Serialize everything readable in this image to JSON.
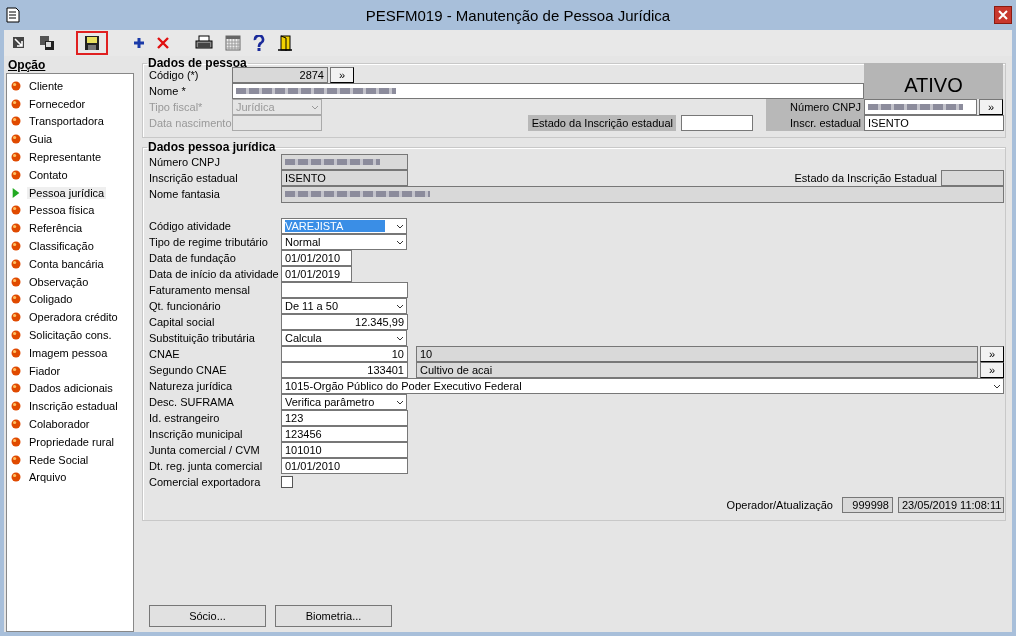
{
  "window": {
    "title": "PESFM019 - Manutenção de Pessoa Jurídica"
  },
  "toolbar_groups": [
    {
      "items": [
        {
          "kind": "arrow",
          "highlighted": false
        },
        {
          "kind": "windows",
          "highlighted": false
        }
      ]
    },
    {
      "items": [
        {
          "kind": "save",
          "highlighted": true
        }
      ]
    },
    {
      "items": [
        {
          "kind": "add",
          "highlighted": false
        },
        {
          "kind": "delete",
          "highlighted": false
        }
      ]
    },
    {
      "items": [
        {
          "kind": "print",
          "highlighted": false
        },
        {
          "kind": "calendar",
          "highlighted": false
        },
        {
          "kind": "help",
          "highlighted": false
        },
        {
          "kind": "exit",
          "highlighted": false
        }
      ]
    }
  ],
  "sidebar": {
    "title": "Opção",
    "items": [
      {
        "label": "Cliente",
        "selected": false
      },
      {
        "label": "Fornecedor",
        "selected": false
      },
      {
        "label": "Transportadora",
        "selected": false
      },
      {
        "label": "Guia",
        "selected": false
      },
      {
        "label": "Representante",
        "selected": false
      },
      {
        "label": "Contato",
        "selected": false
      },
      {
        "label": "Pessoa jurídica",
        "selected": true
      },
      {
        "label": "Pessoa física",
        "selected": false
      },
      {
        "label": "Referência",
        "selected": false
      },
      {
        "label": "Classificação",
        "selected": false
      },
      {
        "label": "Conta bancária",
        "selected": false
      },
      {
        "label": "Observação",
        "selected": false
      },
      {
        "label": "Coligado",
        "selected": false
      },
      {
        "label": "Operadora crédito",
        "selected": false
      },
      {
        "label": "Solicitação cons.",
        "selected": false
      },
      {
        "label": "Imagem pessoa",
        "selected": false
      },
      {
        "label": "Fiador",
        "selected": false
      },
      {
        "label": "Dados adicionais",
        "selected": false
      },
      {
        "label": "Inscrição estadual",
        "selected": false
      },
      {
        "label": "Colaborador",
        "selected": false
      },
      {
        "label": "Propriedade rural",
        "selected": false
      },
      {
        "label": "Rede Social",
        "selected": false
      },
      {
        "label": "Arquivo",
        "selected": false
      }
    ]
  },
  "dados_pessoa": {
    "title": "Dados de pessoa",
    "codigo": {
      "label": "Código (*)",
      "value": "2874",
      "button": "»"
    },
    "nome": {
      "label": "Nome *"
    },
    "tipo_fiscal": {
      "label": "Tipo fiscal*",
      "value": "Jurídica",
      "disabled": true
    },
    "data_nascimento": {
      "label": "Data nascimento",
      "disabled": true
    },
    "estado_inscricao": {
      "label": "Estado da Inscrição estadual"
    },
    "status": "ATIVO",
    "numero_cnpj": {
      "label": "Número CNPJ",
      "button": "»"
    },
    "inscr_estadual": {
      "label": "Inscr. estadual",
      "value": "ISENTO"
    }
  },
  "dados_pj": {
    "title": "Dados pessoa jurídica",
    "numero_cnpj": {
      "label": "Número CNPJ"
    },
    "inscricao_estadual": {
      "label": "Inscrição estadual",
      "value": "ISENTO"
    },
    "estado_inscricao": {
      "label": "Estado da Inscrição Estadual"
    },
    "nome_fantasia": {
      "label": "Nome fantasia"
    },
    "fields": [
      {
        "kind": "select",
        "label": "Código atividade",
        "value": "VAREJISTA",
        "selected": true
      },
      {
        "kind": "select",
        "label": "Tipo de regime tributário",
        "value": "Normal",
        "selected": false
      },
      {
        "kind": "date",
        "label": "Data de fundação",
        "value": "01/01/2010"
      },
      {
        "kind": "date",
        "label": "Data de início da atividade",
        "value": "01/01/2019"
      },
      {
        "kind": "text",
        "label": "Faturamento mensal"
      },
      {
        "kind": "select",
        "label": "Qt. funcionário",
        "value": "De 11 a 50",
        "selected": false
      },
      {
        "kind": "number",
        "label": "Capital social",
        "value": "12.345,99"
      },
      {
        "kind": "select",
        "label": "Substituição tributária",
        "value": "Calcula",
        "selected": false
      },
      {
        "kind": "code",
        "label": "CNAE",
        "value": "10",
        "description": "10",
        "button": "»"
      },
      {
        "kind": "code",
        "label": "Segundo CNAE",
        "value": "133401",
        "description": "Cultivo de acai",
        "button": "»"
      },
      {
        "kind": "wide_select",
        "label": "Natureza jurídica",
        "value": "1015-Orgão Público do Poder Executivo Federal"
      },
      {
        "kind": "select",
        "label": "Desc. SUFRAMA",
        "value": "Verifica parâmetro",
        "selected": false
      },
      {
        "kind": "text",
        "label": "Id. estrangeiro",
        "value": "123"
      },
      {
        "kind": "text",
        "label": "Inscrição municipal",
        "value": "123456"
      },
      {
        "kind": "text",
        "label": "Junta comercial / CVM",
        "value": "101010"
      },
      {
        "kind": "text",
        "label": "Dt. reg. junta comercial",
        "value": "01/01/2010"
      },
      {
        "kind": "checkbox",
        "label": "Comercial exportadora",
        "checked": false
      }
    ],
    "operador": {
      "label": "Operador/Atualização",
      "code": "999998",
      "timestamp": "23/05/2019 11:08:11"
    }
  },
  "buttons": [
    "Sócio...",
    "Biometria..."
  ]
}
